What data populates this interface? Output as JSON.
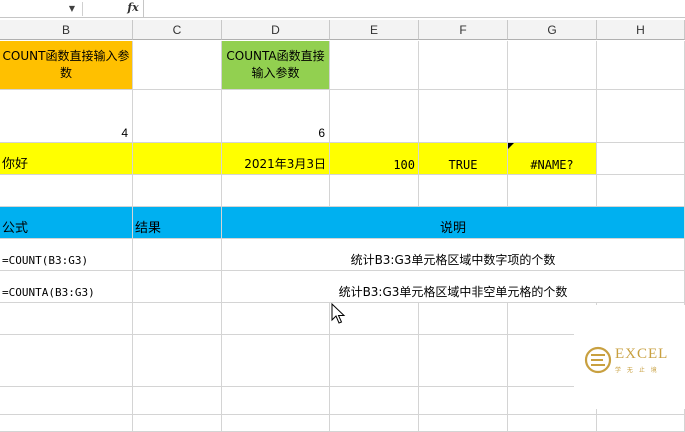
{
  "formula_bar": {
    "fx_label": "fx",
    "dropdown_glyph": "▼",
    "formula": ""
  },
  "columns": [
    "B",
    "C",
    "D",
    "E",
    "F",
    "G",
    "H"
  ],
  "cells": {
    "B1": "COUNT函数直接输入参数",
    "D1": "COUNTA函数直接输入参数",
    "B2": "4",
    "D2": "6",
    "B3": "你好",
    "D3": "2021年3月3日",
    "E3": "100",
    "F3": "TRUE",
    "G3": "#NAME?",
    "B5": "公式",
    "C5": "结果",
    "D5": "说明",
    "B6": "=COUNT(B3:G3)",
    "D6": "统计B3:G3单元格区域中数字项的个数",
    "B7": "=COUNTA(B3:G3)",
    "D7": "统计B3:G3单元格区域中非空单元格的个数"
  },
  "watermark": {
    "text": "EXCEL",
    "subtext": "学 无 止 境"
  },
  "colors": {
    "orange": "#FFC000",
    "green": "#92D050",
    "yellow": "#FFFF00",
    "blue": "#00B0F0",
    "logo": "#C8A040"
  }
}
